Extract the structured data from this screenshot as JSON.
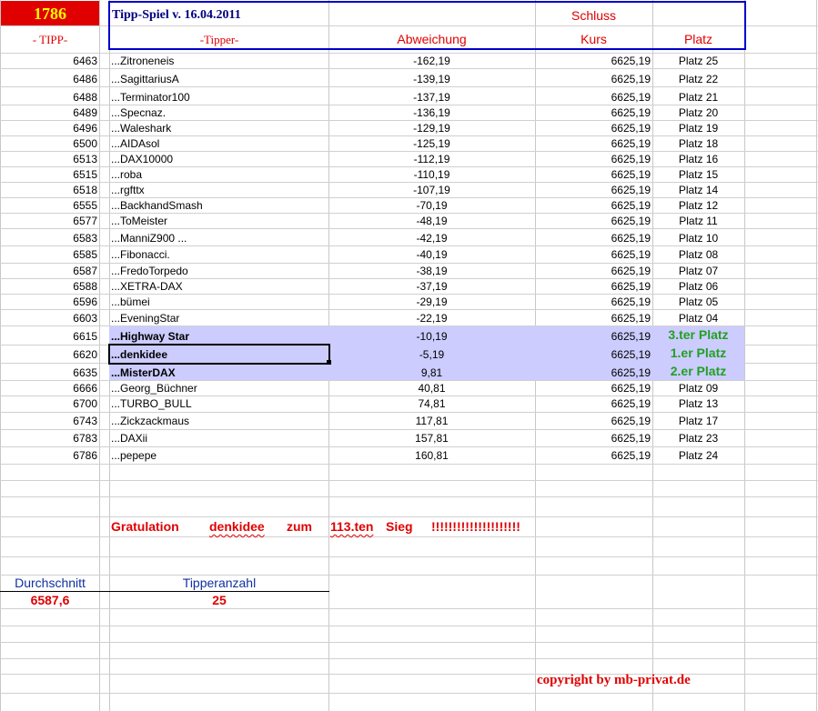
{
  "header": {
    "tipp_count": "1786",
    "title": "Tipp-Spiel v. 16.04.2011",
    "schluss": "Schluss",
    "col_tipp": "- TIPP-",
    "col_tipper": "-Tipper-",
    "col_abweichung": "Abweichung",
    "col_kurs": "Kurs",
    "col_platz": "Platz"
  },
  "colors": {
    "header_red_bg": "#e00000",
    "header_yellow_text": "#ffff00",
    "highlight_bg": "#ccccff",
    "winner_green": "#22a020",
    "frame_blue": "#0000cc"
  },
  "rows": [
    {
      "tipp": "6463",
      "tipper": "...Zitroneneis",
      "abw": "-162,19",
      "kurs": "6625,19",
      "platz": "Platz 25"
    },
    {
      "tipp": "6486",
      "tipper": "...SagittariusA",
      "abw": "-139,19",
      "kurs": "6625,19",
      "platz": "Platz 22"
    },
    {
      "tipp": "6488",
      "tipper": "...Terminator100",
      "abw": "-137,19",
      "kurs": "6625,19",
      "platz": "Platz 21"
    },
    {
      "tipp": "6489",
      "tipper": "...Specnaz.",
      "abw": "-136,19",
      "kurs": "6625,19",
      "platz": "Platz 20"
    },
    {
      "tipp": "6496",
      "tipper": "...Waleshark",
      "abw": "-129,19",
      "kurs": "6625,19",
      "platz": "Platz 19"
    },
    {
      "tipp": "6500",
      "tipper": "...AIDAsol",
      "abw": "-125,19",
      "kurs": "6625,19",
      "platz": "Platz 18"
    },
    {
      "tipp": "6513",
      "tipper": "...DAX10000",
      "abw": "-112,19",
      "kurs": "6625,19",
      "platz": "Platz 16"
    },
    {
      "tipp": "6515",
      "tipper": "...roba",
      "abw": "-110,19",
      "kurs": "6625,19",
      "platz": "Platz 15"
    },
    {
      "tipp": "6518",
      "tipper": "...rgfttx",
      "abw": "-107,19",
      "kurs": "6625,19",
      "platz": "Platz 14"
    },
    {
      "tipp": "6555",
      "tipper": "...BackhandSmash",
      "abw": "-70,19",
      "kurs": "6625,19",
      "platz": "Platz 12"
    },
    {
      "tipp": "6577",
      "tipper": "...ToMeister",
      "abw": "-48,19",
      "kurs": "6625,19",
      "platz": "Platz 11"
    },
    {
      "tipp": "6583",
      "tipper": "...ManniZ900 ...",
      "abw": "-42,19",
      "kurs": "6625,19",
      "platz": "Platz 10"
    },
    {
      "tipp": "6585",
      "tipper": "...Fibonacci.",
      "abw": "-40,19",
      "kurs": "6625,19",
      "platz": "Platz 08"
    },
    {
      "tipp": "6587",
      "tipper": "...FredoTorpedo",
      "abw": "-38,19",
      "kurs": "6625,19",
      "platz": "Platz 07"
    },
    {
      "tipp": "6588",
      "tipper": "...XETRA-DAX",
      "abw": "-37,19",
      "kurs": "6625,19",
      "platz": "Platz 06"
    },
    {
      "tipp": "6596",
      "tipper": "...bümei",
      "abw": "-29,19",
      "kurs": "6625,19",
      "platz": "Platz 05"
    },
    {
      "tipp": "6603",
      "tipper": "...EveningStar",
      "abw": "-22,19",
      "kurs": "6625,19",
      "platz": "Platz 04"
    },
    {
      "tipp": "6615",
      "tipper": "...Highway Star",
      "abw": "-10,19",
      "kurs": "6625,19",
      "platz": "3.ter Platz"
    },
    {
      "tipp": "6620",
      "tipper": "...denkidee",
      "abw": "-5,19",
      "kurs": "6625,19",
      "platz": "1.er Platz"
    },
    {
      "tipp": "6635",
      "tipper": "...MisterDAX",
      "abw": "9,81",
      "kurs": "6625,19",
      "platz": "2.er Platz"
    },
    {
      "tipp": "6666",
      "tipper": "...Georg_Büchner",
      "abw": "40,81",
      "kurs": "6625,19",
      "platz": "Platz 09"
    },
    {
      "tipp": "6700",
      "tipper": "...TURBO_BULL",
      "abw": "74,81",
      "kurs": "6625,19",
      "platz": "Platz 13"
    },
    {
      "tipp": "6743",
      "tipper": "...Zickzackmaus",
      "abw": "117,81",
      "kurs": "6625,19",
      "platz": "Platz 17"
    },
    {
      "tipp": "6783",
      "tipper": "...DAXii",
      "abw": "157,81",
      "kurs": "6625,19",
      "platz": "Platz 23"
    },
    {
      "tipp": "6786",
      "tipper": "...pepepe",
      "abw": "160,81",
      "kurs": "6625,19",
      "platz": "Platz 24"
    }
  ],
  "congrats": {
    "word1": "Gratulation",
    "name": "denkidee",
    "word2": "zum",
    "count": "113.ten",
    "word3": "Sieg",
    "bangs": "!!!!!!!!!!!!!!!!!!!!!"
  },
  "stats": {
    "avg_label": "Durchschnitt",
    "avg_value": "6587,6",
    "count_label": "Tipperanzahl",
    "count_value": "25"
  },
  "copyright": "copyright by mb-privat.de"
}
